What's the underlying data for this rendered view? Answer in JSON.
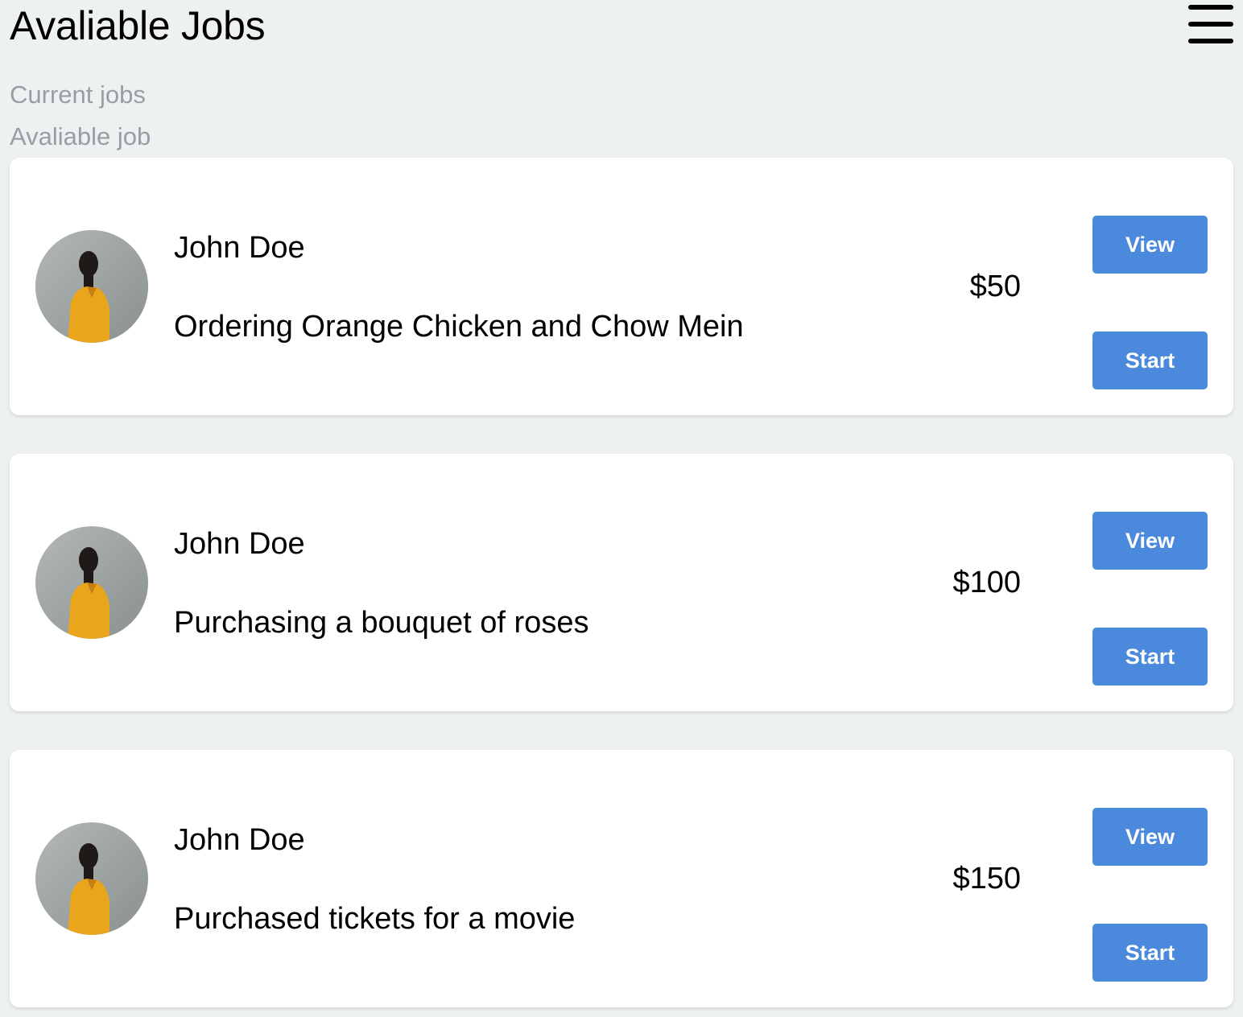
{
  "header": {
    "title": "Avaliable Jobs",
    "menu_icon": "hamburger-menu-icon"
  },
  "nav": {
    "current_jobs": "Current jobs",
    "available_job": "Avaliable job"
  },
  "colors": {
    "background": "#eef1f2",
    "card": "#ffffff",
    "button": "#4a89dc",
    "nav_text": "#9a9ea1"
  },
  "jobs": [
    {
      "name": "John Doe",
      "description": "Ordering Orange Chicken and Chow Mein",
      "price": "$50",
      "view_label": "View",
      "start_label": "Start",
      "avatar_icon": "user-avatar"
    },
    {
      "name": "John Doe",
      "description": "Purchasing a bouquet of roses",
      "price": "$100",
      "view_label": "View",
      "start_label": "Start",
      "avatar_icon": "user-avatar"
    },
    {
      "name": "John Doe",
      "description": "Purchased tickets for a movie",
      "price": "$150",
      "view_label": "View",
      "start_label": "Start",
      "avatar_icon": "user-avatar"
    }
  ]
}
